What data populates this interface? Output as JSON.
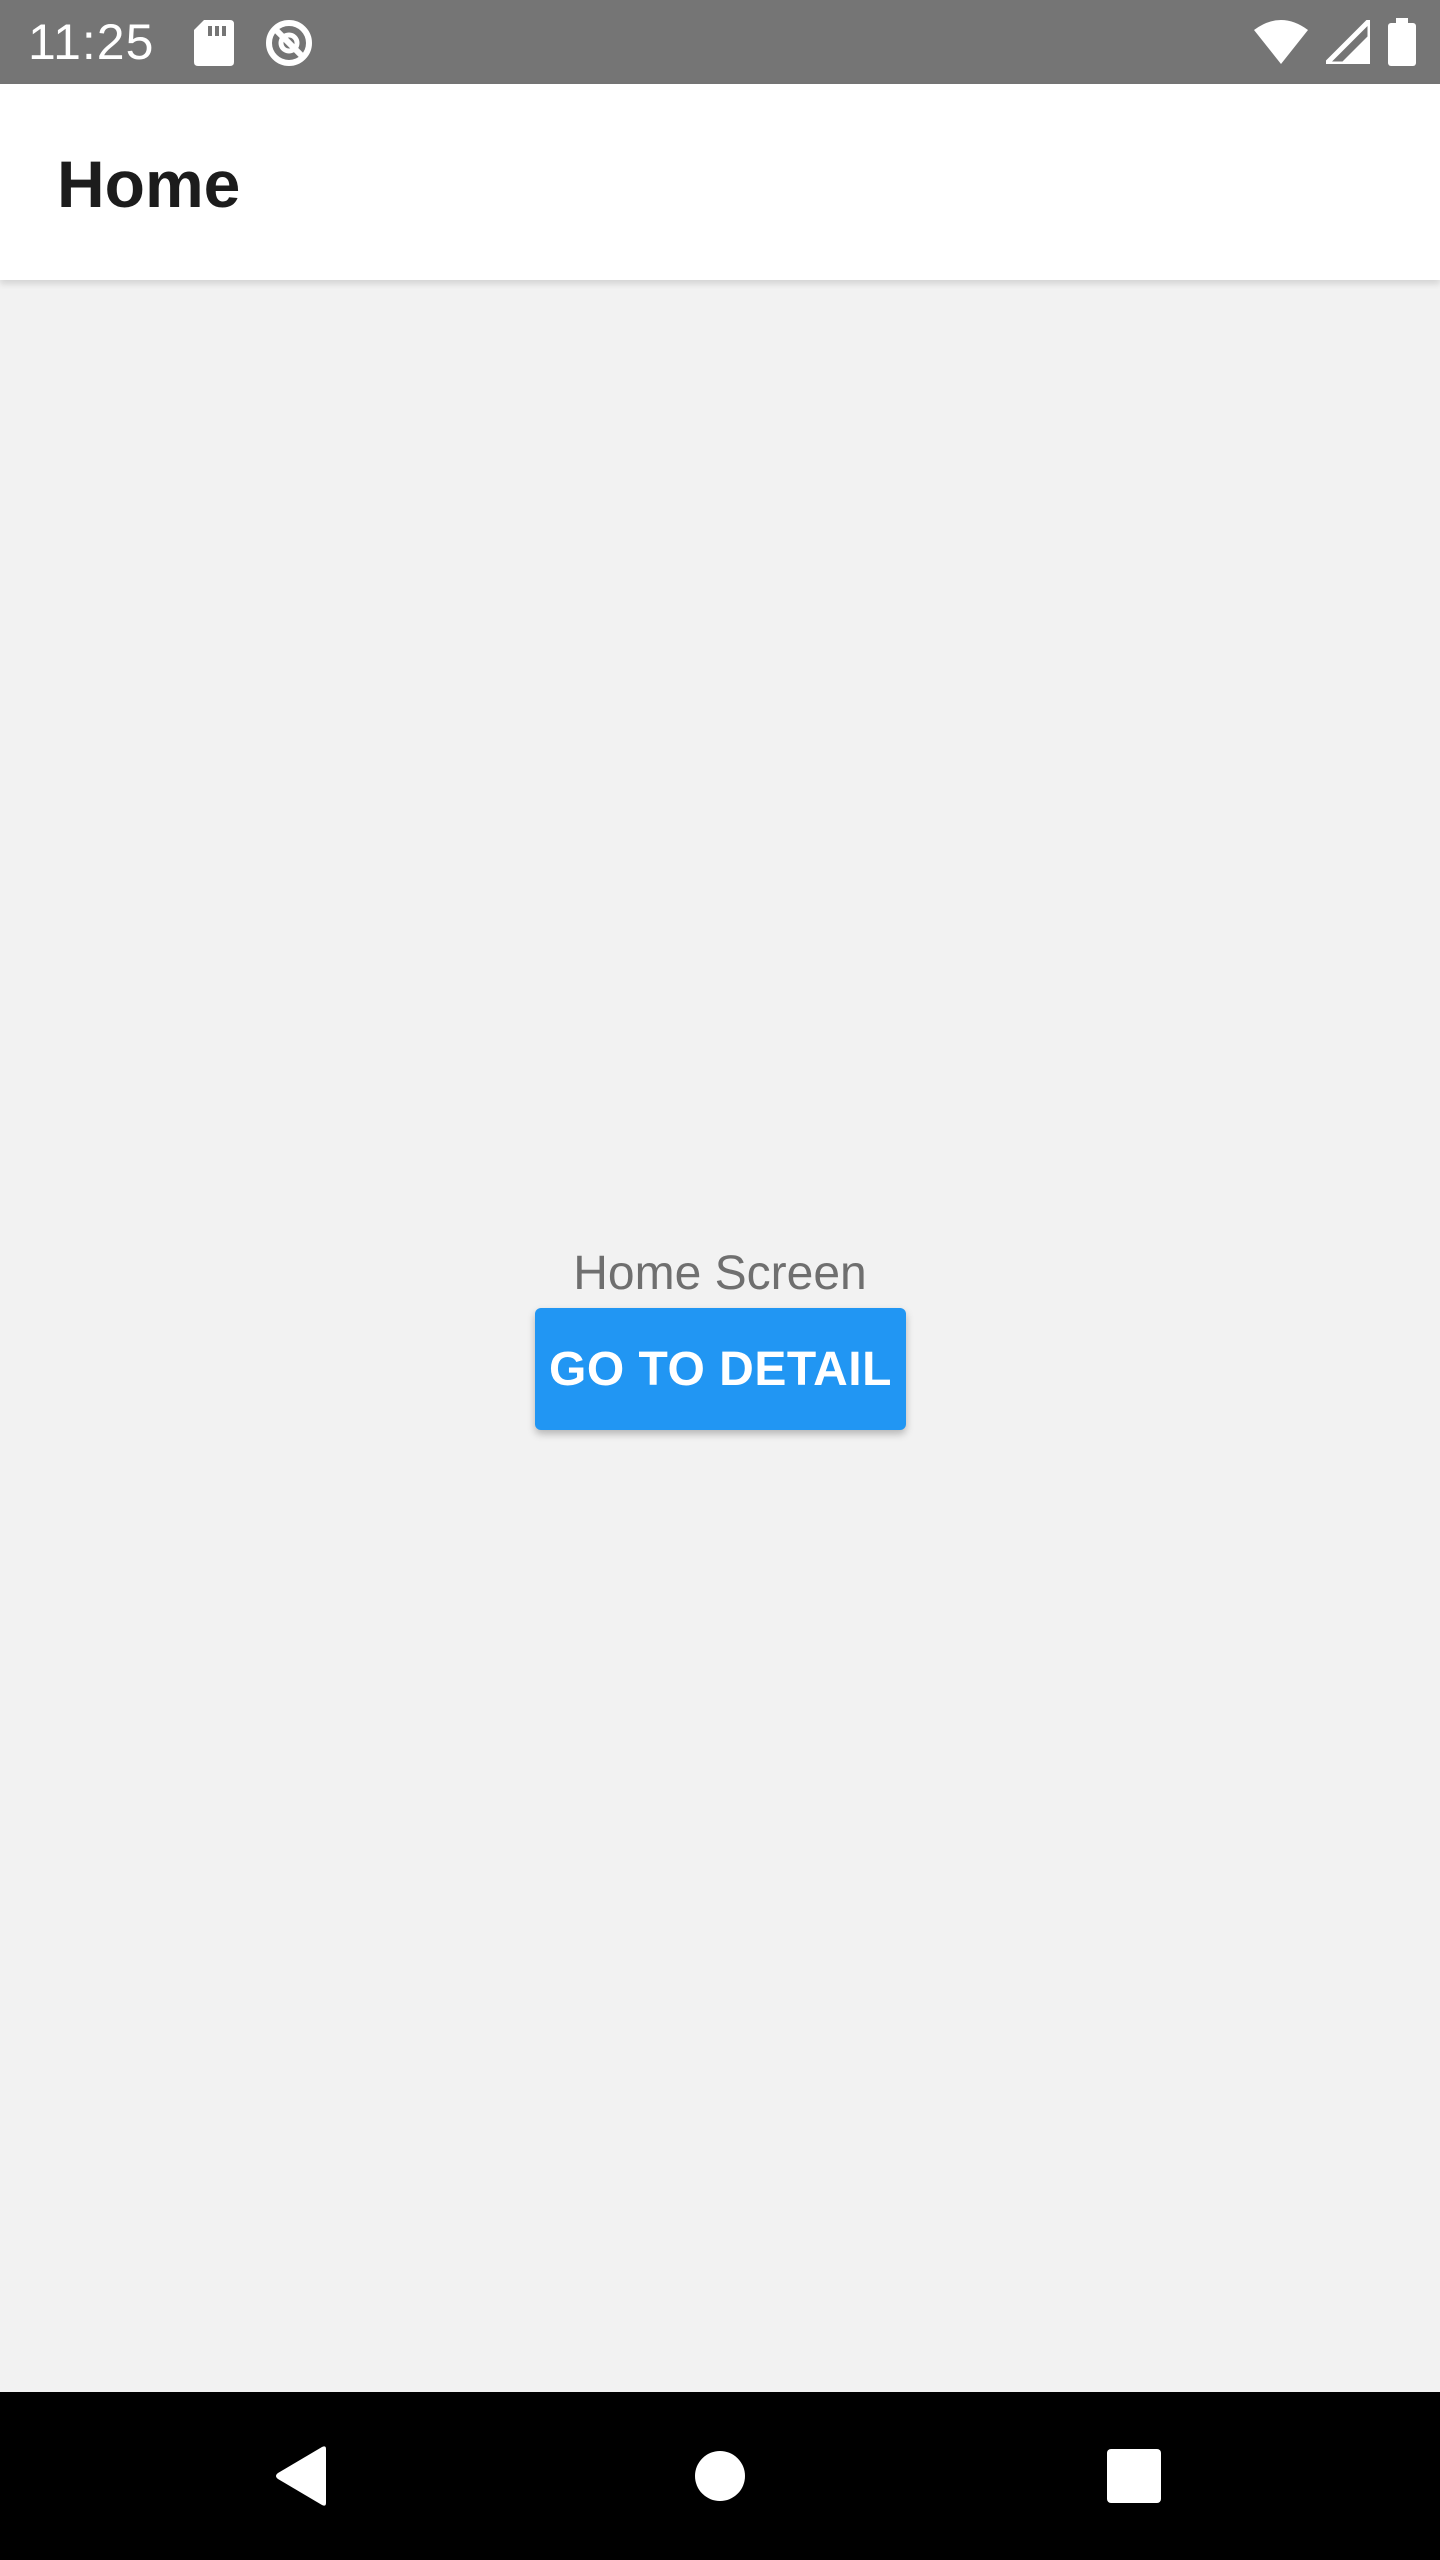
{
  "status_bar": {
    "time": "11:25",
    "left_icons": [
      "sd-card-icon",
      "do-not-disturb-icon"
    ],
    "right_icons": [
      "wifi-icon",
      "cellular-signal-icon",
      "battery-icon"
    ],
    "background": "#757575"
  },
  "app_bar": {
    "title": "Home"
  },
  "main": {
    "label": "Home Screen",
    "button_label": "GO TO DETAIL",
    "button_color": "#2196f3"
  },
  "nav_bar": {
    "icons": [
      "back-icon",
      "home-icon",
      "recents-icon"
    ]
  }
}
